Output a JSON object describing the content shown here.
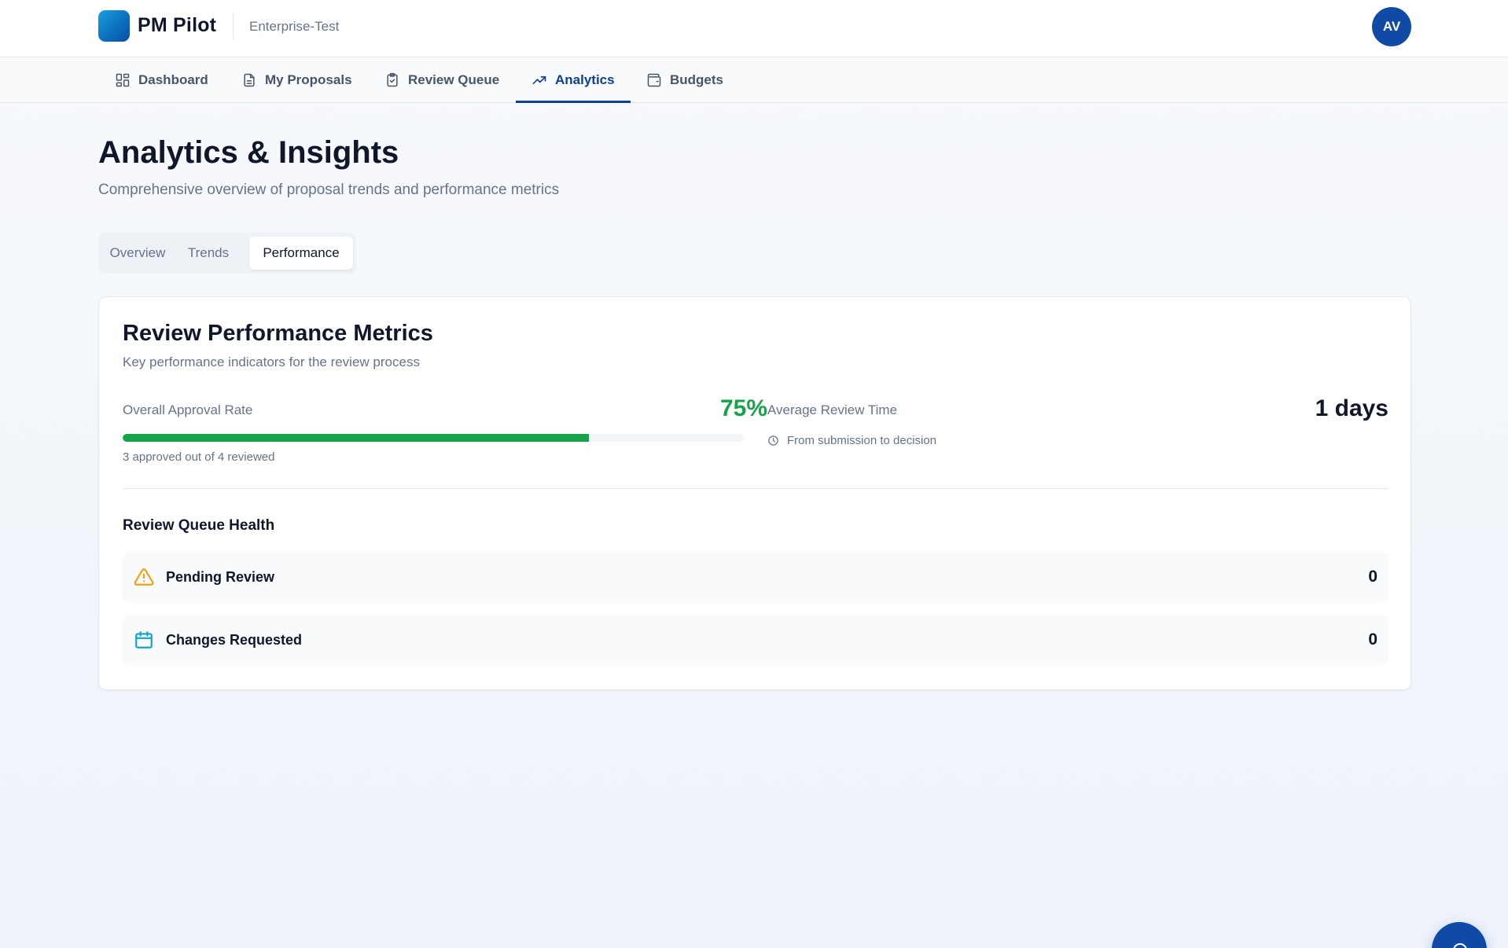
{
  "header": {
    "app_name": "PM Pilot",
    "organization": "Enterprise-Test",
    "avatar_initials": "AV"
  },
  "nav": {
    "items": [
      {
        "label": "Dashboard",
        "icon": "grid-icon"
      },
      {
        "label": "My Proposals",
        "icon": "document-icon"
      },
      {
        "label": "Review Queue",
        "icon": "clipboard-check-icon"
      },
      {
        "label": "Analytics",
        "icon": "trending-up-icon",
        "active": true
      },
      {
        "label": "Budgets",
        "icon": "wallet-icon"
      }
    ]
  },
  "page": {
    "title": "Analytics & Insights",
    "subtitle": "Comprehensive overview of proposal trends and performance metrics"
  },
  "tabs": {
    "items": [
      {
        "label": "Overview"
      },
      {
        "label": "Trends"
      },
      {
        "label": "Performance",
        "active": true
      }
    ]
  },
  "performance_card": {
    "title": "Review Performance Metrics",
    "subtitle": "Key performance indicators for the review process",
    "approval": {
      "label": "Overall Approval Rate",
      "value": "75%",
      "progress_fraction": 0.75,
      "note": "3 approved out of 4 reviewed"
    },
    "review_time": {
      "label": "Average Review Time",
      "value": "1 days",
      "note": "From submission to decision"
    },
    "queue_health": {
      "title": "Review Queue Health",
      "rows": [
        {
          "label": "Pending Review",
          "count": "0",
          "icon": "alert-triangle-icon"
        },
        {
          "label": "Changes Requested",
          "count": "0",
          "icon": "calendar-icon"
        }
      ]
    }
  },
  "colors": {
    "primary": "#0e3f96",
    "avatar": "#0e4aa6",
    "success": "#16a34a",
    "warning": "#f59e0b",
    "info": "#0ea5c9"
  }
}
